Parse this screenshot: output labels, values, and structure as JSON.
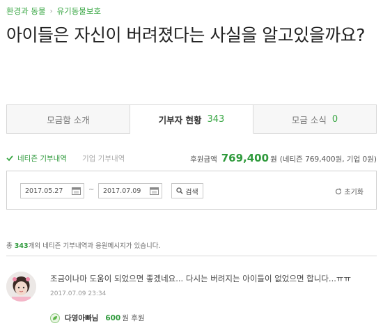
{
  "breadcrumb": {
    "category": "환경과 동물",
    "subcategory": "유기동물보호"
  },
  "title": "아이들은 자신이 버려졌다는 사실을 알고있을까요?",
  "tabs": [
    {
      "label": "모금함 소개",
      "count": ""
    },
    {
      "label": "기부자 현황",
      "count": "343"
    },
    {
      "label": "모금 소식",
      "count": "0"
    }
  ],
  "filters": {
    "netizen": "네티즌 기부내역",
    "company": "기업 기부내역"
  },
  "summary": {
    "label": "후원금액",
    "amount": "769,400",
    "unit": "원",
    "detail": "(네티즌 769,400원, 기업 0원)"
  },
  "search": {
    "start_date": "2017.05.27",
    "end_date": "2017.07.09",
    "tilde": "~",
    "button": "검색",
    "reset": "초기화"
  },
  "total": {
    "prefix": "총",
    "count": "343",
    "suffix": "개의 네티즌 기부내역과 응원메시지가 있습니다."
  },
  "comments": [
    {
      "text": "조금이나마 도움이 되었으면 좋겠네요... 다시는 버려지는 아이들이 없었으면 합니다...ㅠㅠ",
      "date": "2017.07.09 23:34",
      "donor": "다영아빠님",
      "amount": "600",
      "amount_unit": "원 후원"
    }
  ],
  "colors": {
    "accent": "#3aa745",
    "amount": "#2f9a3c",
    "border": "#d8d8d8"
  }
}
